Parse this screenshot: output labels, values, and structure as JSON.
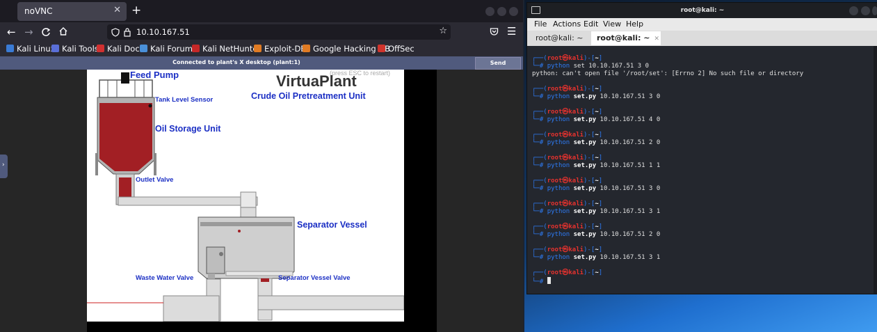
{
  "browser": {
    "tab_title": "noVNC",
    "tab_close": "✕",
    "new_tab": "+",
    "url": "10.10.167.51",
    "bookmarks": [
      "Kali Linux",
      "Kali Tools",
      "Kali Docs",
      "Kali Forums",
      "Kali NetHunter",
      "Exploit-DB",
      "Google Hacking DB",
      "OffSec"
    ]
  },
  "novnc": {
    "status": "Connected to plant's X desktop (plant:1)",
    "send_cad": "Send CtrlAltDel"
  },
  "plant": {
    "feed_pump": "Feed Pump",
    "title": "VirtuaPlant",
    "subtitle": "Crude Oil Pretreatment Unit",
    "esc_hint": "(press ESC to restart)",
    "tank_level_sensor": "Tank Level Sensor",
    "oil_storage": "Oil Storage Unit",
    "outlet_valve": "Outlet Valve",
    "separator_vessel": "Separator Vessel",
    "waste_water_valve": "Waste Water Valve",
    "separator_vessel_valve": "Separator Vessel Valve"
  },
  "terminal": {
    "title": "root@kali: ~",
    "menu": [
      "File",
      "Actions",
      "Edit",
      "View",
      "Help"
    ],
    "tabs": [
      "root@kali: ~",
      "root@kali: ~"
    ],
    "prompt_head": "┌──(",
    "prompt_user": "root㉿kali",
    "prompt_mid": ")-[",
    "prompt_dir": "~",
    "prompt_end": "]",
    "prompt_hash": "└─# ",
    "entries": [
      {
        "cmd": "python",
        "script": " set",
        "args": " 10.10.167.51 3 0",
        "output": "python: can't open file '/root/set': [Errno 2] No such file or directory"
      },
      {
        "cmd": "python",
        "script": " set.py",
        "args": " 10.10.167.51 3 0",
        "output": ""
      },
      {
        "cmd": "python",
        "script": " set.py",
        "args": " 10.10.167.51 4 0",
        "output": ""
      },
      {
        "cmd": "python",
        "script": " set.py",
        "args": " 10.10.167.51 2 0",
        "output": ""
      },
      {
        "cmd": "python",
        "script": " set.py",
        "args": " 10.10.167.51 1 1",
        "output": ""
      },
      {
        "cmd": "python",
        "script": " set.py",
        "args": " 10.10.167.51 3 0",
        "output": ""
      },
      {
        "cmd": "python",
        "script": " set.py",
        "args": " 10.10.167.51 3 1",
        "output": ""
      },
      {
        "cmd": "python",
        "script": " set.py",
        "args": " 10.10.167.51 2 0",
        "output": ""
      },
      {
        "cmd": "python",
        "script": " set.py",
        "args": " 10.10.167.51 3 1",
        "output": ""
      }
    ]
  }
}
